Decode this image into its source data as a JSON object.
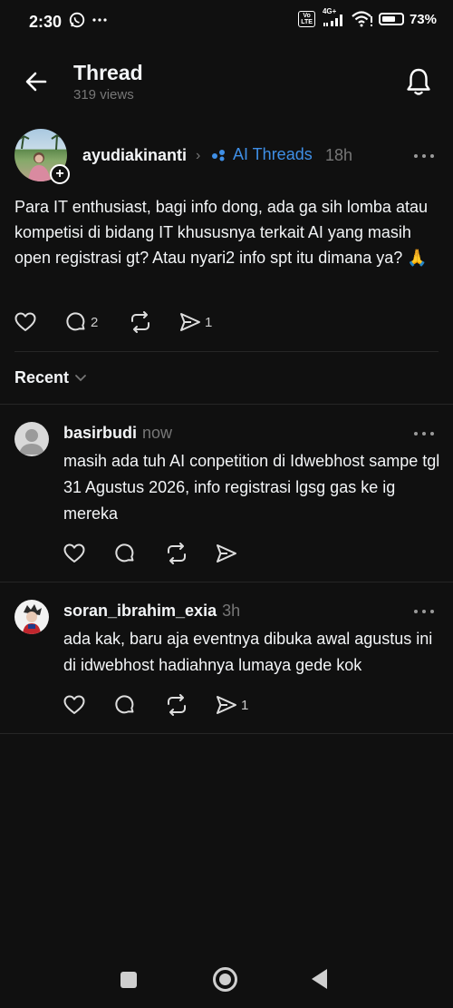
{
  "status_bar": {
    "time": "2:30",
    "left_icons": [
      "whatsapp-icon",
      "more-dots-icon"
    ],
    "volte_label": "Vo\nLTE",
    "network_label": "4G+",
    "battery": "73%"
  },
  "header": {
    "title": "Thread",
    "views": "319 views",
    "back_icon": "arrow-left-icon",
    "bell_icon": "bell-icon"
  },
  "post": {
    "username": "ayudiakinanti",
    "topic": "AI Threads",
    "time": "18h",
    "body": "Para IT enthusiast, bagi info dong, ada ga sih lomba atau kompetisi di bidang IT khususnya terkait AI yang masih open registrasi gt? Atau nyari2 info spt itu dimana ya? 🙏",
    "reply_count": "2",
    "repost_count": "",
    "share_count": "1"
  },
  "sort": {
    "label": "Recent"
  },
  "replies": [
    {
      "username": "basirbudi",
      "time": "now",
      "body": "masih ada tuh AI conpetition di Idwebhost sampe tgl 31 Agustus 2026, info registrasi lgsg gas ke ig mereka",
      "share_count": ""
    },
    {
      "username": "soran_ibrahim_exia",
      "time": "3h",
      "body": "ada kak, baru aja eventnya dibuka awal agustus ini di idwebhost hadiahnya lumaya gede kok",
      "share_count": "1"
    }
  ],
  "colors": {
    "background": "#101010",
    "text": "#f3f5f7",
    "secondary": "#777777",
    "topic": "#3f8fe6"
  }
}
